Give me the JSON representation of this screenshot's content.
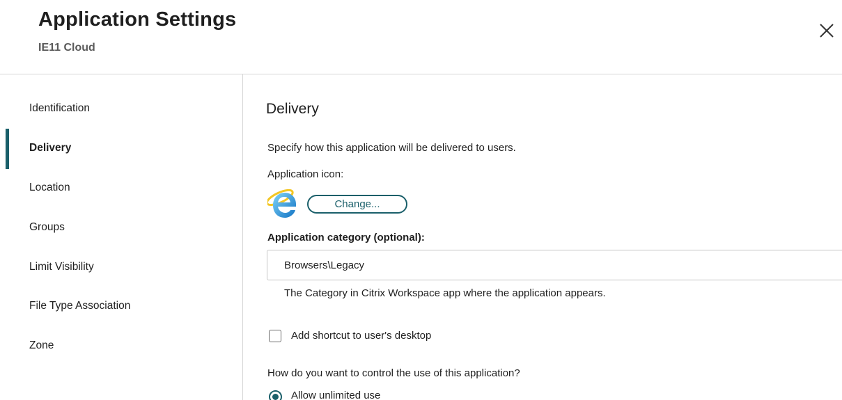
{
  "header": {
    "title": "Application Settings",
    "subtitle": "IE11 Cloud",
    "close_icon": "close-icon"
  },
  "sidebar": {
    "items": [
      {
        "label": "Identification",
        "active": false
      },
      {
        "label": "Delivery",
        "active": true
      },
      {
        "label": "Location",
        "active": false
      },
      {
        "label": "Groups",
        "active": false
      },
      {
        "label": "Limit Visibility",
        "active": false
      },
      {
        "label": "File Type Association",
        "active": false
      },
      {
        "label": "Zone",
        "active": false
      }
    ]
  },
  "main": {
    "section_title": "Delivery",
    "description": "Specify how this application will be delivered to users.",
    "app_icon_label": "Application icon:",
    "app_icon": "internet-explorer-icon",
    "change_button": "Change...",
    "category_label": "Application category (optional):",
    "category_value": "Browsers\\Legacy",
    "category_helper": "The Category in Citrix Workspace app where the application appears.",
    "shortcut_label": "Add shortcut to user's desktop",
    "shortcut_checked": false,
    "control_question": "How do you want to control the use of this application?",
    "control_option": "Allow unlimited use",
    "control_option_selected": true
  },
  "colors": {
    "accent": "#1a5f6a",
    "border": "#d6d6d6",
    "text": "#1f1f1f",
    "subtitle": "#5a5a5a"
  }
}
